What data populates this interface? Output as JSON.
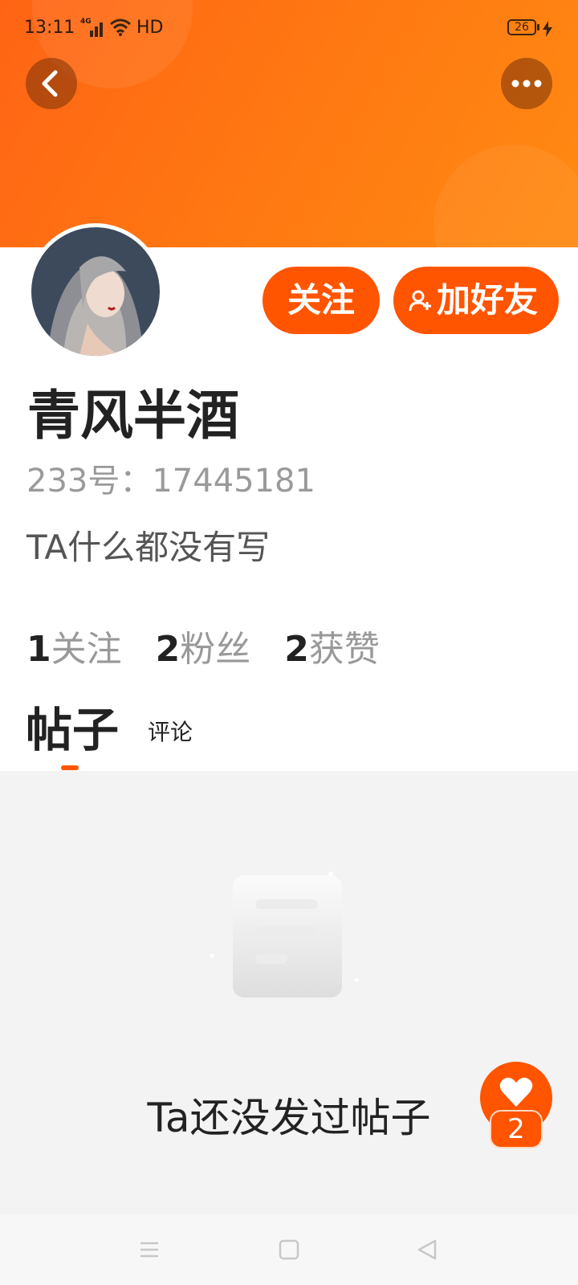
{
  "status_bar": {
    "time": "13:11",
    "network": "4G",
    "hd": "HD",
    "battery": "26"
  },
  "profile": {
    "username": "青风半酒",
    "user_id": "233号：17445181",
    "bio": "TA什么都没有写"
  },
  "actions": {
    "follow_label": "关注",
    "add_friend_label": "加好友"
  },
  "stats": [
    {
      "count": "1",
      "label": "关注"
    },
    {
      "count": "2",
      "label": "粉丝"
    },
    {
      "count": "2",
      "label": "获赞"
    }
  ],
  "tabs": {
    "posts": "帖子",
    "comments": "评论"
  },
  "empty_state": {
    "text": "Ta还没发过帖子"
  },
  "like_fab": {
    "count": "2"
  },
  "colors": {
    "accent": "#ff5400",
    "header": "#ff7414"
  }
}
